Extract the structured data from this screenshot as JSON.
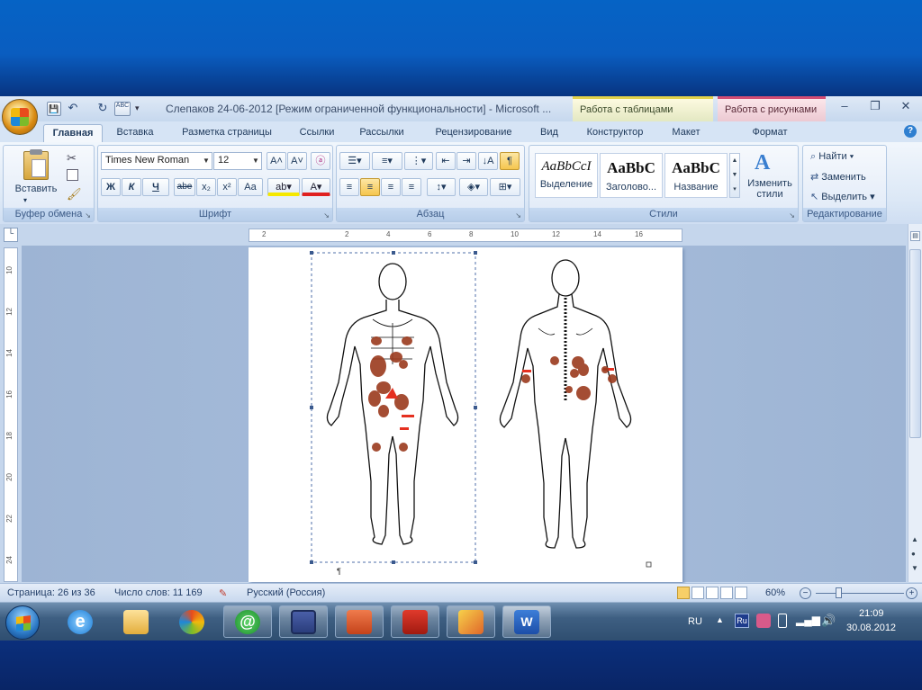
{
  "window": {
    "title": "Слепаков 24-06-2012 [Режим ограниченной функциональности] - Microsoft ...",
    "contextual": {
      "tables": "Работа с таблицами",
      "pictures": "Работа с рисунками"
    },
    "controls": {
      "minimize": "–",
      "restore": "❐",
      "close": "✕"
    }
  },
  "qat": {
    "save": "💾",
    "undo": "↶",
    "redo": "↻",
    "spell": "ABC"
  },
  "tabs": [
    "Главная",
    "Вставка",
    "Разметка страницы",
    "Ссылки",
    "Рассылки",
    "Рецензирование",
    "Вид",
    "Конструктор",
    "Макет",
    "Формат"
  ],
  "ribbon": {
    "clipboard": {
      "paste": "Вставить",
      "label": "Буфер обмена"
    },
    "font": {
      "name": "Times New Roman",
      "size": "12",
      "bold": "Ж",
      "italic": "К",
      "underline": "Ч",
      "strike": "abe",
      "sub": "x₂",
      "sup": "x²",
      "case": "Aa",
      "grow": "A˄",
      "shrink": "A˅",
      "label": "Шрифт"
    },
    "paragraph": {
      "label": "Абзац",
      "pilcrow": "¶"
    },
    "styles": {
      "items": [
        {
          "sample": "AaBbCcI",
          "name": "Выделение"
        },
        {
          "sample": "AaBbC",
          "name": "Заголово..."
        },
        {
          "sample": "AaBbC",
          "name": "Название"
        }
      ],
      "change": "Изменить стили",
      "label": "Стили"
    },
    "editing": {
      "find": "Найти",
      "replace": "Заменить",
      "select": "Выделить",
      "label": "Редактирование"
    }
  },
  "ruler": {
    "h_labels": [
      "2",
      "",
      "2",
      "4",
      "6",
      "8",
      "10",
      "12",
      "14",
      "16"
    ],
    "v_labels": [
      "10",
      "12",
      "14",
      "16",
      "18",
      "20",
      "22",
      "24"
    ]
  },
  "document": {
    "pilcrow": "¶"
  },
  "status": {
    "page": "Страница: 26 из 36",
    "words": "Число слов: 11 169",
    "lang": "Русский (Россия)",
    "zoom": "60%"
  },
  "taskbar": {
    "lang": "RU",
    "lang_badge": "Ru",
    "time": "21:09",
    "date": "30.08.2012",
    "apps": [
      "internet-explorer",
      "file-explorer",
      "paint",
      "mail-agent",
      "save-disk",
      "powerpoint",
      "acrobat",
      "photo-app",
      "word"
    ]
  },
  "colors": {
    "accent": "#0563c5",
    "ribbon": "#dce8f6",
    "lesion": "#9b3a1e",
    "lesion_red": "#e53020"
  }
}
